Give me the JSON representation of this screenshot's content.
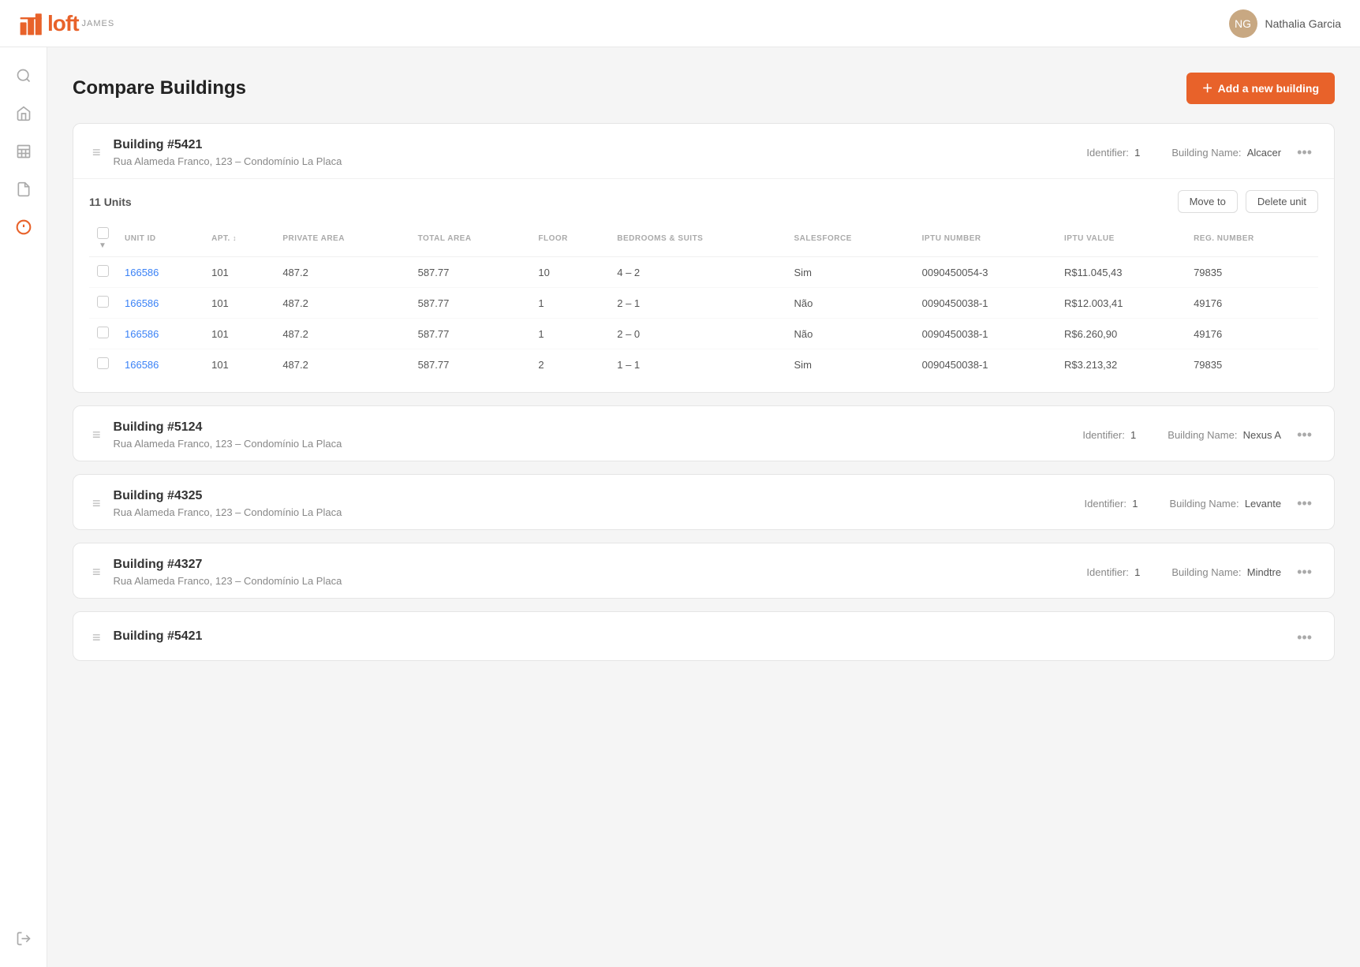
{
  "brand": {
    "name": "loft",
    "subtitle": "JAMES"
  },
  "user": {
    "name": "Nathalia Garcia",
    "initials": "NG"
  },
  "page": {
    "title": "Compare Buildings",
    "add_button": "Add a new building"
  },
  "sidebar": {
    "items": [
      {
        "icon": "search",
        "label": "Search",
        "active": false
      },
      {
        "icon": "home",
        "label": "Home",
        "active": false
      },
      {
        "icon": "building",
        "label": "Buildings",
        "active": false
      },
      {
        "icon": "document",
        "label": "Documents",
        "active": false
      },
      {
        "icon": "alert",
        "label": "Alerts",
        "active": true,
        "alert": true
      }
    ],
    "bottom": [
      {
        "icon": "logout",
        "label": "Logout"
      }
    ]
  },
  "buildings": [
    {
      "id": "5421",
      "name": "Building #5421",
      "address": "Rua Alameda Franco, 123 – Condomínio La Placa",
      "identifier": "1",
      "building_name_label": "Building Name:",
      "building_name_value": "Alcacer",
      "has_units": true,
      "units_count": "11 Units",
      "units": [
        {
          "unit_id": "166586",
          "apt": "101",
          "private_area": "487.2",
          "total_area": "587.77",
          "floor": "10",
          "bedrooms": "4 – 2",
          "salesforce": "Sim",
          "iptu_number": "0090450054-3",
          "iptu_value": "R$11.045,43",
          "reg_number": "79835"
        },
        {
          "unit_id": "166586",
          "apt": "101",
          "private_area": "487.2",
          "total_area": "587.77",
          "floor": "1",
          "bedrooms": "2 – 1",
          "salesforce": "Não",
          "iptu_number": "0090450038-1",
          "iptu_value": "R$12.003,41",
          "reg_number": "49176"
        },
        {
          "unit_id": "166586",
          "apt": "101",
          "private_area": "487.2",
          "total_area": "587.77",
          "floor": "1",
          "bedrooms": "2 – 0",
          "salesforce": "Não",
          "iptu_number": "0090450038-1",
          "iptu_value": "R$6.260,90",
          "reg_number": "49176"
        },
        {
          "unit_id": "166586",
          "apt": "101",
          "private_area": "487.2",
          "total_area": "587.77",
          "floor": "2",
          "bedrooms": "1 – 1",
          "salesforce": "Sim",
          "iptu_number": "0090450038-1",
          "iptu_value": "R$3.213,32",
          "reg_number": "79835"
        }
      ],
      "table_headers": [
        "",
        "UNIT ID",
        "APT.",
        "PRIVATE AREA",
        "TOTAL AREA",
        "FLOOR",
        "BEDROOMS & SUITS",
        "SALESFORCE",
        "IPTU NUMBER",
        "IPTU VALUE",
        "REG. NUMBER"
      ]
    },
    {
      "id": "5124",
      "name": "Building #5124",
      "address": "Rua Alameda Franco, 123 – Condomínio La Placa",
      "identifier": "1",
      "building_name_label": "Building Name:",
      "building_name_value": "Nexus A",
      "has_units": false
    },
    {
      "id": "4325",
      "name": "Building #4325",
      "address": "Rua Alameda Franco, 123 – Condomínio La Placa",
      "identifier": "1",
      "building_name_label": "Building Name:",
      "building_name_value": "Levante",
      "has_units": false
    },
    {
      "id": "4327",
      "name": "Building #4327",
      "address": "Rua Alameda Franco, 123 – Condomínio La Placa",
      "identifier": "1",
      "building_name_label": "Building Name:",
      "building_name_value": "Mindtre",
      "has_units": false
    },
    {
      "id": "5421b",
      "name": "Building #5421",
      "address": "",
      "identifier": "",
      "building_name_label": "",
      "building_name_value": "",
      "has_units": false,
      "partial": true
    }
  ],
  "labels": {
    "identifier": "Identifier:",
    "move_to": "Move to",
    "delete_unit": "Delete unit"
  }
}
